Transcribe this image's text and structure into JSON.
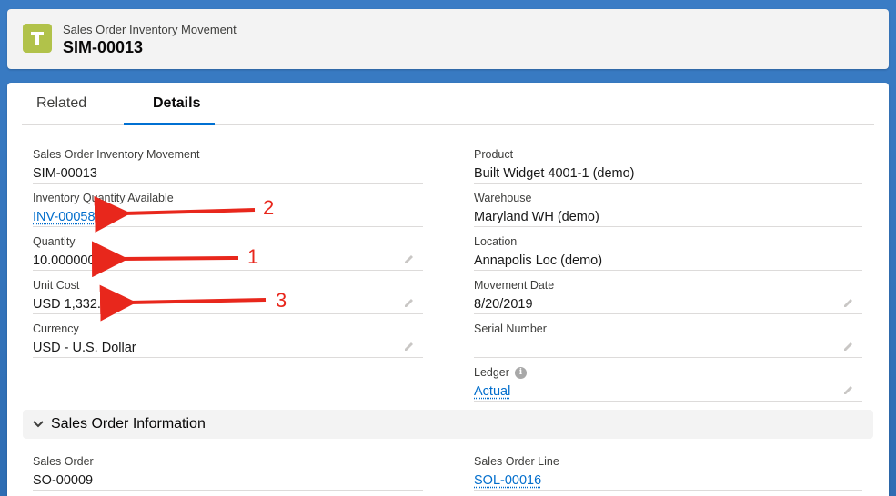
{
  "header": {
    "object_label": "Sales Order Inventory Movement",
    "record_name": "SIM-00013",
    "icon": "hammer-icon",
    "icon_color": "#b1c24a"
  },
  "tabs": [
    {
      "label": "Related",
      "active": false
    },
    {
      "label": "Details",
      "active": true
    }
  ],
  "fields_left": [
    {
      "label": "Sales Order Inventory Movement",
      "value": "SIM-00013",
      "link": false,
      "editable": false
    },
    {
      "label": "Inventory Quantity Available",
      "value": "INV-00058",
      "link": true,
      "editable": false
    },
    {
      "label": "Quantity",
      "value": "10.000000",
      "link": false,
      "editable": true
    },
    {
      "label": "Unit Cost",
      "value": "USD 1,332.74",
      "link": false,
      "editable": true
    },
    {
      "label": "Currency",
      "value": "USD - U.S. Dollar",
      "link": false,
      "editable": true
    }
  ],
  "fields_right": [
    {
      "label": "Product",
      "value": "Built Widget 4001-1 (demo)",
      "link": false,
      "editable": false
    },
    {
      "label": "Warehouse",
      "value": "Maryland WH (demo)",
      "link": false,
      "editable": false
    },
    {
      "label": "Location",
      "value": "Annapolis Loc (demo)",
      "link": false,
      "editable": false
    },
    {
      "label": "Movement Date",
      "value": "8/20/2019",
      "link": false,
      "editable": true
    },
    {
      "label": "Serial Number",
      "value": "",
      "link": false,
      "editable": true
    },
    {
      "label": "Ledger",
      "value": "Actual",
      "link": true,
      "editable": true,
      "info": true
    }
  ],
  "section": {
    "title": "Sales Order Information",
    "expanded": true
  },
  "section_fields_left": [
    {
      "label": "Sales Order",
      "value": "SO-00009",
      "link": false
    }
  ],
  "section_fields_right": [
    {
      "label": "Sales Order Line",
      "value": "SOL-00016",
      "link": true
    }
  ],
  "annotations": [
    {
      "label": "2",
      "target": "Inventory Quantity Available"
    },
    {
      "label": "1",
      "target": "Quantity"
    },
    {
      "label": "3",
      "target": "Unit Cost"
    }
  ],
  "colors": {
    "link": "#006dcc",
    "active_tab": "#0070d2",
    "annotation": "#e8271c"
  }
}
